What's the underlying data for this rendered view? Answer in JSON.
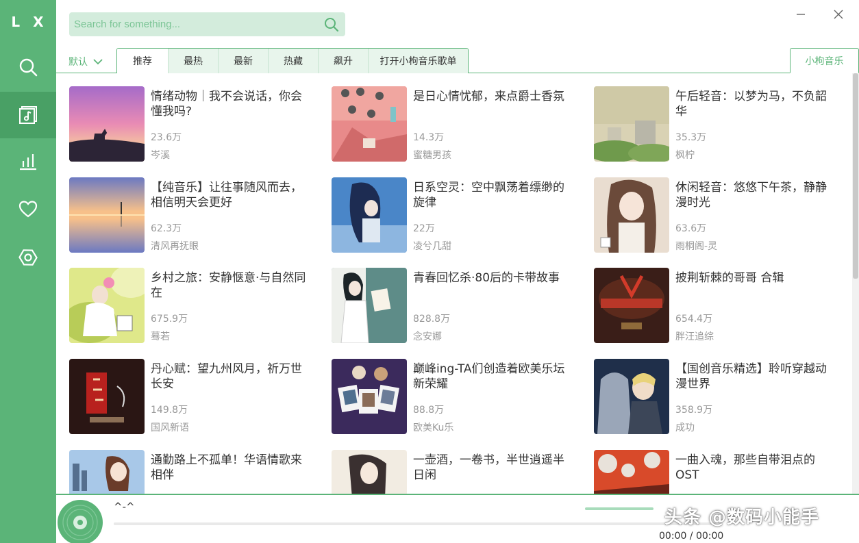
{
  "app": {
    "logo": "L X"
  },
  "sidebar": {
    "items": [
      {
        "name": "search",
        "icon": "search-icon",
        "active": false
      },
      {
        "name": "songlist",
        "icon": "music-list-icon",
        "active": true
      },
      {
        "name": "leaderboard",
        "icon": "chart-icon",
        "active": false
      },
      {
        "name": "favorites",
        "icon": "heart-icon",
        "active": false
      },
      {
        "name": "settings",
        "icon": "settings-icon",
        "active": false
      }
    ]
  },
  "search": {
    "placeholder": "Search for something..."
  },
  "window": {
    "minimize_icon": "minimize-icon",
    "close_icon": "close-icon"
  },
  "toolbar": {
    "sort_label": "默认",
    "tabs": [
      "推荐",
      "最热",
      "最新",
      "热藏",
      "飙升",
      "打开小枸音乐歌单"
    ],
    "active_tab": 0,
    "source_label": "小枸音乐"
  },
  "playlists": [
    {
      "title": "情绪动物｜我不会说话，你会懂我吗?",
      "plays": "23.6万",
      "author": "岑溪"
    },
    {
      "title": "是日心情忧郁，来点爵士香氛",
      "plays": "14.3万",
      "author": "蜜糖男孩"
    },
    {
      "title": "午后轻音：以梦为马，不负韶华",
      "plays": "35.3万",
      "author": "枫柠"
    },
    {
      "title": "【纯音乐】让往事随风而去，相信明天会更好",
      "plays": "62.3万",
      "author": "清风再抚眼"
    },
    {
      "title": "日系空灵：空中飘荡着缥缈的旋律",
      "plays": "22万",
      "author": "凌兮几甜"
    },
    {
      "title": "休闲轻音：悠悠下午茶，静静漫时光",
      "plays": "63.6万",
      "author": "雨桐阁-灵"
    },
    {
      "title": "乡村之旅：安静惬意·与自然同在",
      "plays": "675.9万",
      "author": "蓦若"
    },
    {
      "title": "青春回忆杀·80后的卡带故事",
      "plays": "828.8万",
      "author": "念安娜"
    },
    {
      "title": "披荆斩棘的哥哥 合辑",
      "plays": "654.4万",
      "author": "胖汪追综"
    },
    {
      "title": "丹心赋：望九州风月，祈万世长安",
      "plays": "149.8万",
      "author": "国风新语"
    },
    {
      "title": "巅峰ing-TA们创造着欧美乐坛新荣耀",
      "plays": "88.8万",
      "author": "欧美Ku乐"
    },
    {
      "title": "【国创音乐精选】聆听穿越动漫世界",
      "plays": "358.9万",
      "author": "成功"
    },
    {
      "title": "通勤路上不孤单！华语情歌来相伴",
      "plays": "",
      "author": ""
    },
    {
      "title": "一壶酒，一卷书，半世逍遥半日闲",
      "plays": "",
      "author": ""
    },
    {
      "title": "一曲入魂，那些自带泪点的OST",
      "plays": "",
      "author": ""
    }
  ],
  "player": {
    "song_title": "^-^",
    "time": "00:00 / 00:00",
    "progress": 0,
    "disc_icon": "disc-icon"
  },
  "watermark": "头条 @数码小能手",
  "colors": {
    "accent": "#5bb478",
    "accent_dark": "#49a065",
    "search_bg": "#d3ecdc"
  }
}
